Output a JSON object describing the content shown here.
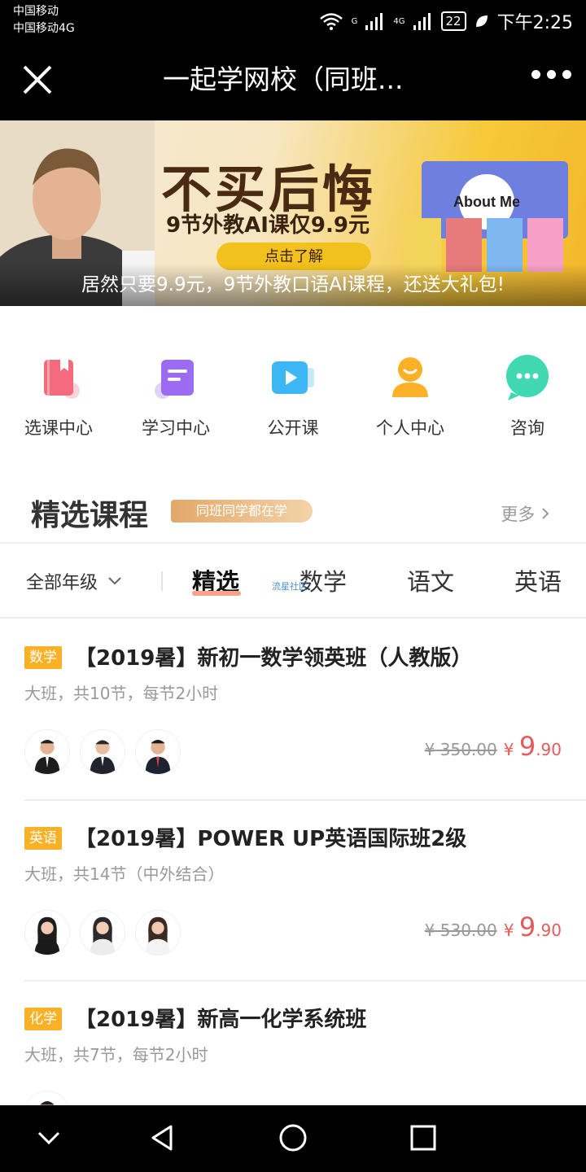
{
  "status": {
    "carrier1": "中国移动",
    "carrier2": "中国移动4G",
    "network_a": "G",
    "network_b": "4G",
    "battery": "22",
    "time": "下午2:25"
  },
  "nav": {
    "title": "一起学网校（同班...",
    "close_icon": "close-icon",
    "more_icon": "more-icon"
  },
  "banner": {
    "headline": "不买后悔",
    "subline": "9节外教AI课仅9.9元",
    "button": "点击了解",
    "caption": "居然只要9.9元，9节外教口语AI课程，还送大礼包!",
    "book_text": "About Me"
  },
  "quick_links": [
    {
      "label": "选课中心",
      "icon": "book-icon",
      "color": "#f36b7c"
    },
    {
      "label": "学习中心",
      "icon": "notes-icon",
      "color": "#9b6cf0"
    },
    {
      "label": "公开课",
      "icon": "play-icon",
      "color": "#3cb6f5"
    },
    {
      "label": "个人中心",
      "icon": "user-icon",
      "color": "#fbb125"
    },
    {
      "label": "咨询",
      "icon": "chat-icon",
      "color": "#3fd8b0"
    }
  ],
  "section": {
    "title": "精选课程",
    "tag": "同班同学都在学",
    "more": "更多"
  },
  "filter": {
    "grade": "全部年级",
    "tabs": [
      "精选",
      "数学",
      "语文",
      "英语"
    ],
    "active_tab": "精选",
    "watermark": "流星社区"
  },
  "courses": [
    {
      "subject": "数学",
      "title": "【2019暑】新初一数学领英班（人教版）",
      "desc": "大班，共10节，每节2小时",
      "original_price": "¥ 350.00",
      "price_symbol": "¥",
      "price_int": "9",
      "price_dec": ".90"
    },
    {
      "subject": "英语",
      "title": "【2019暑】POWER UP英语国际班2级",
      "desc": "大班，共14节（中外结合）",
      "original_price": "¥ 530.00",
      "price_symbol": "¥",
      "price_int": "9",
      "price_dec": ".90"
    },
    {
      "subject": "化学",
      "title": "【2019暑】新高一化学系统班",
      "desc": "大班，共7节，每节2小时"
    }
  ],
  "colors": {
    "accent_orange": "#fbb125",
    "price_red": "#e35b5b",
    "tab_underline": "#f9a287"
  }
}
